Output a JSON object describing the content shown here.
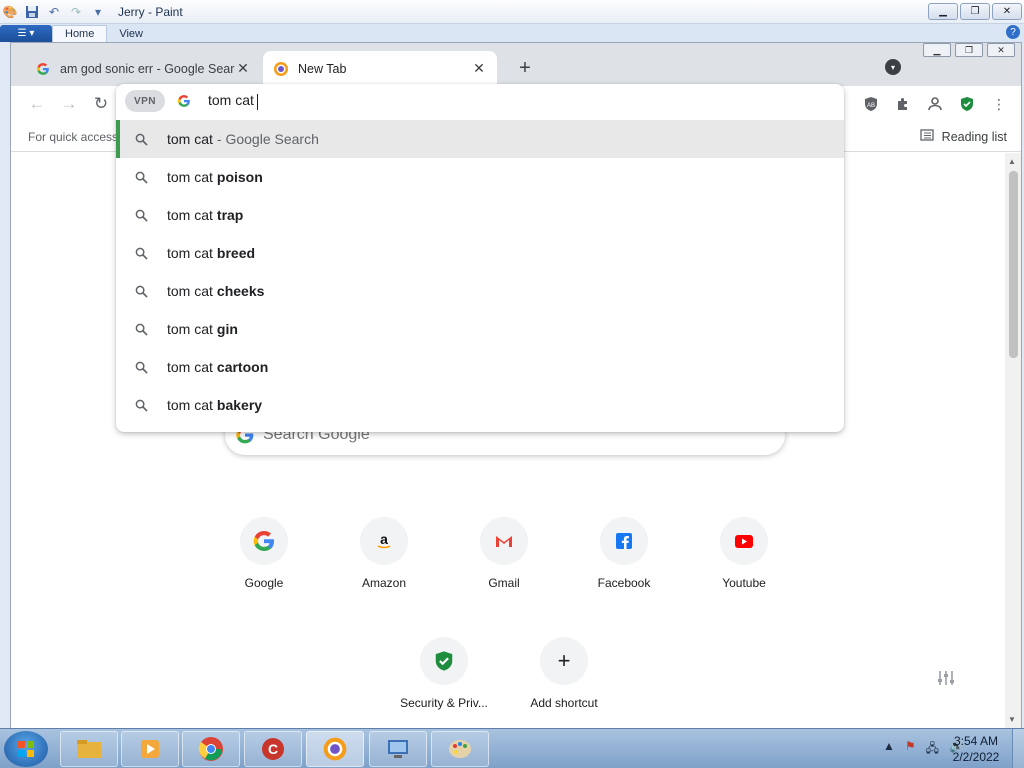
{
  "paint": {
    "title": "Jerry - Paint",
    "tabs": [
      "Home",
      "View"
    ]
  },
  "chrome": {
    "tabs": [
      {
        "title": "am god sonic err - Google Search",
        "active": false
      },
      {
        "title": "New Tab",
        "active": true
      }
    ],
    "omnibox": {
      "vpn_label": "VPN",
      "text": "tom cat"
    },
    "bookmarks_bar": {
      "hint": "For quick access,",
      "reading_list": "Reading list"
    },
    "suggestions": [
      {
        "base": "tom cat",
        "extra": "",
        "tail": "- Google Search",
        "selected": true
      },
      {
        "base": "tom cat",
        "extra": "poison",
        "tail": "",
        "selected": false
      },
      {
        "base": "tom cat",
        "extra": "trap",
        "tail": "",
        "selected": false
      },
      {
        "base": "tom cat",
        "extra": "breed",
        "tail": "",
        "selected": false
      },
      {
        "base": "tom cat",
        "extra": "cheeks",
        "tail": "",
        "selected": false
      },
      {
        "base": "tom cat",
        "extra": "gin",
        "tail": "",
        "selected": false
      },
      {
        "base": "tom cat",
        "extra": "cartoon",
        "tail": "",
        "selected": false
      },
      {
        "base": "tom cat",
        "extra": "bakery",
        "tail": "",
        "selected": false
      }
    ],
    "ntp": {
      "search_placeholder": "Search Google",
      "shortcuts": [
        {
          "label": "Google",
          "icon": "google-icon"
        },
        {
          "label": "Amazon",
          "icon": "amazon-icon"
        },
        {
          "label": "Gmail",
          "icon": "gmail-icon"
        },
        {
          "label": "Facebook",
          "icon": "facebook-icon"
        },
        {
          "label": "Youtube",
          "icon": "youtube-icon"
        },
        {
          "label": "Security & Priv...",
          "icon": "shield-check-icon"
        },
        {
          "label": "Add shortcut",
          "icon": "plus-icon"
        }
      ]
    }
  },
  "taskbar": {
    "time": "3:54 AM",
    "date": "2/2/2022"
  },
  "colors": {
    "selected_accent": "#3c9b4f",
    "taskbar": "#8fb0d6"
  }
}
